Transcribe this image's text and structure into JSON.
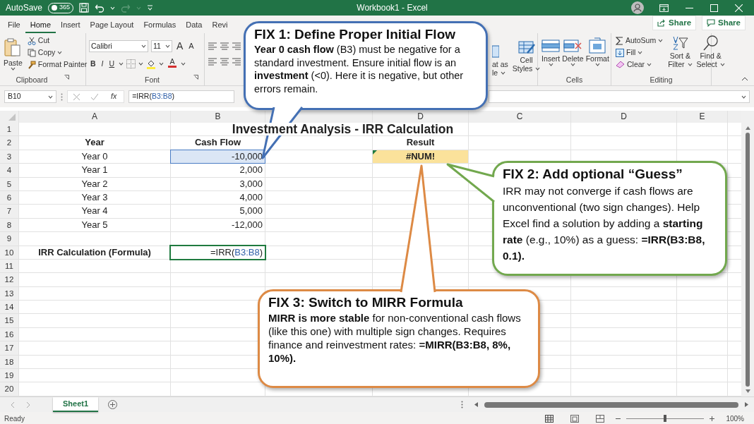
{
  "window": {
    "autosave_label": "AutoSave",
    "autosave_toggle": {
      "text": "365",
      "on": false
    },
    "title": "Workbook1 - Excel"
  },
  "ribbon_tabs": [
    {
      "label": "File",
      "selected": false
    },
    {
      "label": "Home",
      "selected": true
    },
    {
      "label": "Insert",
      "selected": false
    },
    {
      "label": "Page Layout",
      "selected": false
    },
    {
      "label": "Formulas",
      "selected": false
    },
    {
      "label": "Data",
      "selected": false
    },
    {
      "label": "Revi",
      "selected": false
    }
  ],
  "share_buttons": [
    {
      "kind": "share",
      "label": "Share"
    },
    {
      "kind": "comment",
      "label": "Share"
    }
  ],
  "clipboard": {
    "paste": "Paste",
    "cut": "Cut",
    "copy": "Copy",
    "format_painter": "Format Painter",
    "label": "Clipboard"
  },
  "font": {
    "name": "Calibri",
    "size": "11",
    "grow": "A",
    "shrink": "A",
    "bold": "B",
    "italic": "I",
    "underline": "U",
    "font_color": "A",
    "label": "Font"
  },
  "styles": {
    "partial_button": [
      "at as",
      "le"
    ],
    "cell_styles": [
      "Cell",
      "Styles"
    ]
  },
  "cells_group": {
    "buttons": [
      {
        "kind": "insert",
        "label": "Insert"
      },
      {
        "kind": "delete",
        "label": "Delete"
      },
      {
        "kind": "format",
        "label": "Format"
      }
    ],
    "label": "Cells"
  },
  "editing": {
    "autosum": "AutoSum",
    "fill": "Fill",
    "clear": "Clear",
    "sort_filter": [
      "Sort &",
      "Filter"
    ],
    "find_select": [
      "Find &",
      "Select"
    ],
    "label": "Editing"
  },
  "formula_bar": {
    "name_box": "B10",
    "fx": "fx",
    "formula": [
      {
        "text": "=IRR("
      },
      {
        "text": "B3:B8",
        "ref": true
      },
      {
        "text": ")"
      }
    ]
  },
  "column_headers": [
    "A",
    "B",
    "D",
    "C",
    "D",
    "E"
  ],
  "rows": [
    {
      "number": "1",
      "kind": "title",
      "title": "Investment Analysis - IRR Calculation"
    },
    {
      "number": "2",
      "kind": "header",
      "a": "Year",
      "b": "Cash Flow",
      "d": "Result"
    },
    {
      "number": "3",
      "kind": "data",
      "a": "Year 0",
      "b": "-10,000",
      "b_selected": true,
      "d": "#NUM!",
      "d_error": true
    },
    {
      "number": "4",
      "kind": "data",
      "a": "Year 1",
      "b": "2,000",
      "b_selected": false
    },
    {
      "number": "5",
      "kind": "data",
      "a": "Year 2",
      "b": "3,000",
      "b_selected": false
    },
    {
      "number": "6",
      "kind": "data",
      "a": "Year 3",
      "b": "4,000",
      "b_selected": false
    },
    {
      "number": "7",
      "kind": "data",
      "a": "Year 4",
      "b": "5,000",
      "b_selected": false
    },
    {
      "number": "8",
      "kind": "data",
      "a": "Year 5",
      "b": "-12,000",
      "b_selected": false
    },
    {
      "number": "9",
      "kind": "blank"
    },
    {
      "number": "10",
      "kind": "formula",
      "a": "IRR Calculation (Formula)",
      "b_formula": [
        {
          "text": "=IRR("
        },
        {
          "text": "B3:B8",
          "ref": true
        },
        {
          "text": ")"
        }
      ],
      "b_active": true
    },
    {
      "number": "11",
      "kind": "blank"
    },
    {
      "number": "12",
      "kind": "blank"
    },
    {
      "number": "13",
      "kind": "blank"
    },
    {
      "number": "14",
      "kind": "blank"
    },
    {
      "number": "15",
      "kind": "blank"
    },
    {
      "number": "16",
      "kind": "blank"
    },
    {
      "number": "17",
      "kind": "blank"
    },
    {
      "number": "18",
      "kind": "blank"
    },
    {
      "number": "19",
      "kind": "blank"
    },
    {
      "number": "20",
      "kind": "blank"
    }
  ],
  "callouts": [
    {
      "title": "FIX 1: Define Proper Initial Flow",
      "body": "**Year 0 cash flow** (B3) must be negative for a standard investment. Ensure initial flow is an **investment** (<0). Here it is negative, but other errors remain.",
      "color": "#4470b4"
    },
    {
      "title": "FIX 2: Add optional “Guess”",
      "body": "IRR may not converge if cash flows are unconventional (two sign changes). Help Excel find a solution by adding a **starting rate** (e.g., 10%) as a guess: **=IRR(B3:B8, 0.1).**",
      "color": "#72a84e"
    },
    {
      "title": "FIX 3: Switch to MIRR Formula",
      "body": "**MIRR is more stable** for non-conventional cash flows (like this one) with multiple sign changes. Requires finance and reinvestment rates: **=MIRR(B3:B8, 8%, 10%).**",
      "color": "#dd8a45"
    }
  ],
  "sheet_tabs": [
    {
      "label": "Sheet1",
      "selected": true
    }
  ],
  "status_bar": {
    "text": "Ready",
    "zoom_slider": {
      "level": 0.5
    },
    "zoom": "100%"
  }
}
